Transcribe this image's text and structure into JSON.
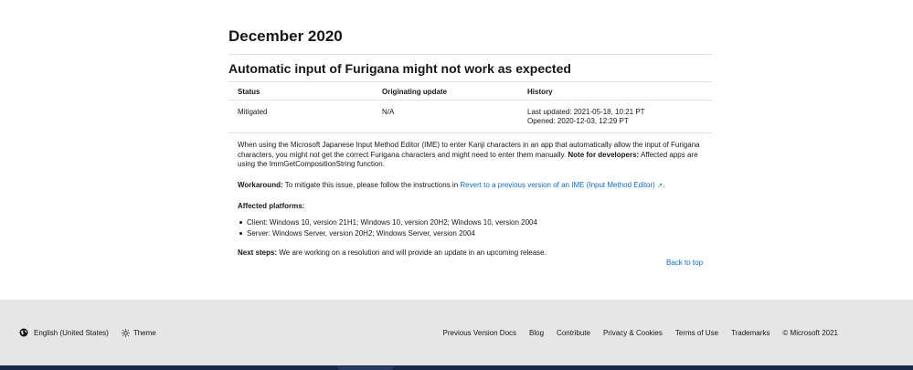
{
  "page": {
    "title": "December 2020",
    "issue_title": "Automatic input of Furigana might not work as expected"
  },
  "table": {
    "headers": [
      "Status",
      "Originating update",
      "History"
    ],
    "status": "Mitigated",
    "originating_update": "N/A",
    "history_line1": "Last updated: 2021-05-18, 10:21 PT",
    "history_line2": "Opened: 2020-12-03, 12:29 PT"
  },
  "body": {
    "paragraph": "When using the Microsoft Japanese Input Method Editor (IME) to enter Kanji characters in an app that automatically allow the input of Furigana characters, you might not get the correct Furigana characters and might need to enter them manually.",
    "note_label": "Note for developers:",
    "note_text": "Affected apps are using the ImmGetCompositionString function.",
    "workaround_label": "Workaround:",
    "workaround_text": "To mitigate this issue, please follow the instructions in",
    "workaround_link": "Revert to a previous version of an IME (Input Method Editor)",
    "affected_platforms_title": "Affected platforms:",
    "platforms": [
      "Client: Windows 10, version 21H1; Windows 10, version 20H2; Windows 10, version 2004",
      "Server: Windows Server, version 20H2; Windows Server, version 2004"
    ],
    "next_steps_label": "Next steps:",
    "next_steps_text": "We are working on a resolution and will provide an update in an upcoming release.",
    "back_to_top": "Back to top"
  },
  "footer": {
    "language": "English (United States)",
    "theme": "Theme",
    "links": [
      "Previous Version Docs",
      "Blog",
      "Contribute",
      "Privacy & Cookies",
      "Terms of Use",
      "Trademarks",
      "© Microsoft 2021"
    ],
    "icons": {
      "language": "globe-icon",
      "theme": "sun-icon",
      "external": "external-link-icon"
    }
  }
}
